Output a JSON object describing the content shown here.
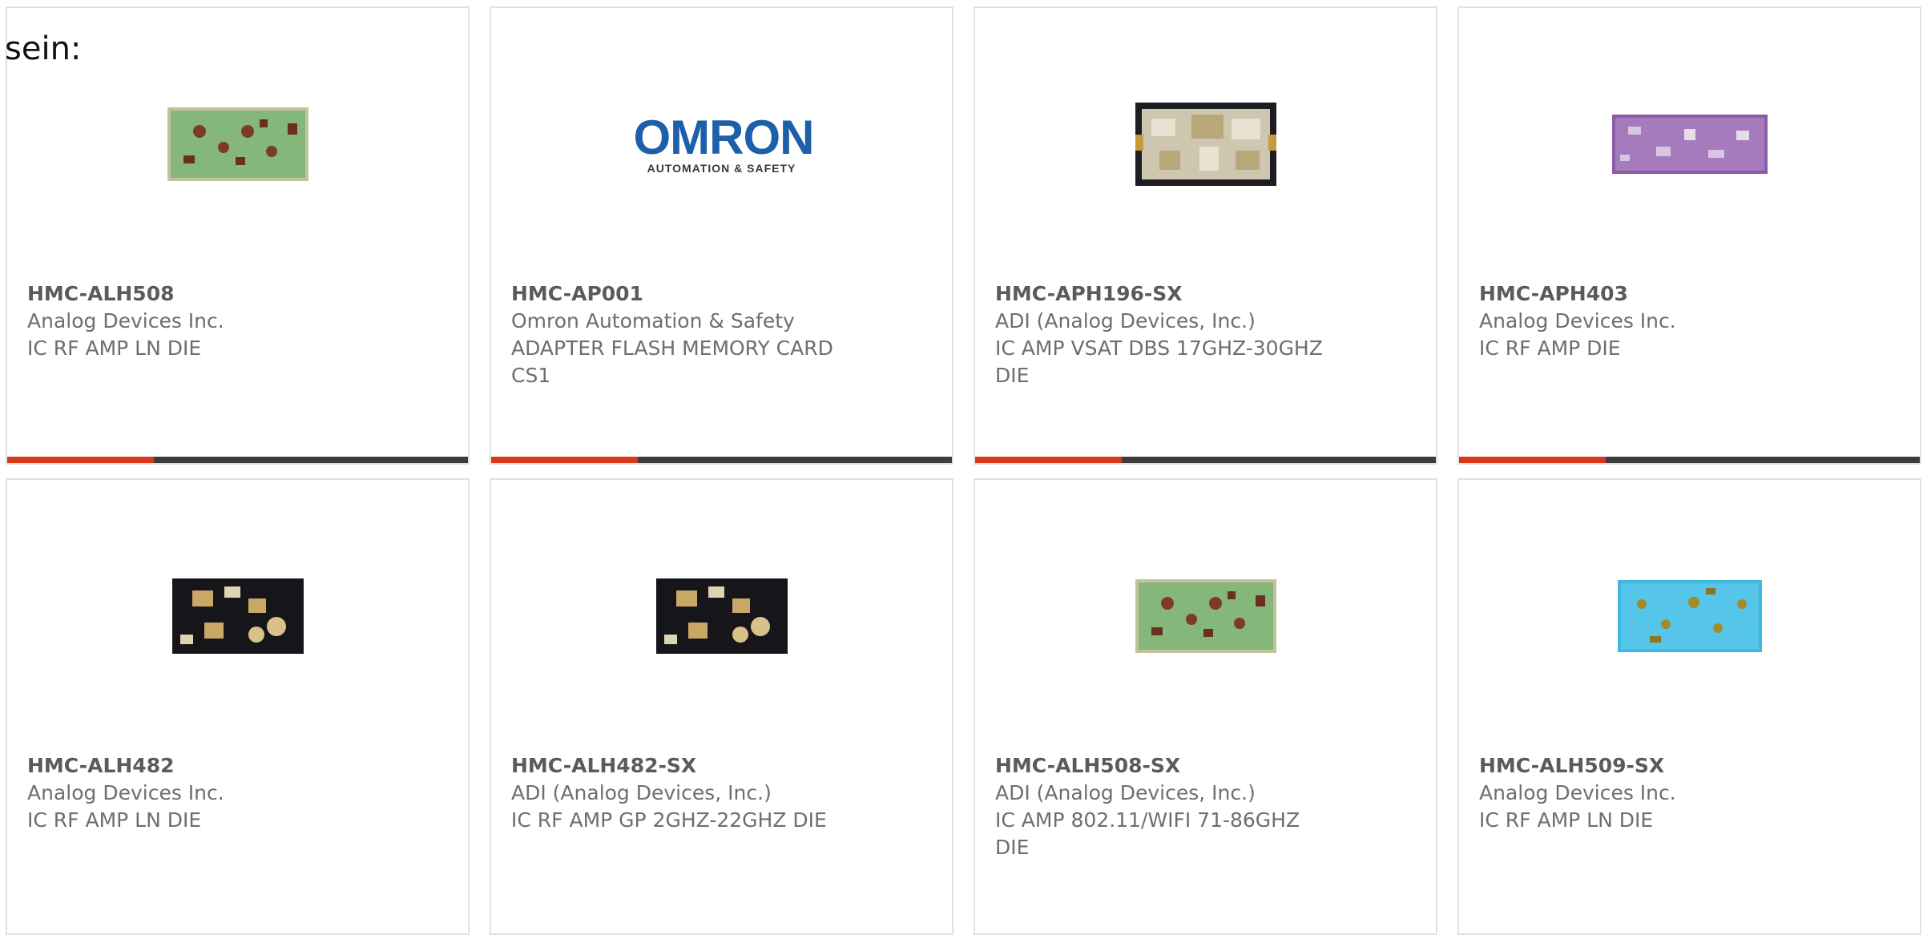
{
  "heading_fragment": "sein:",
  "accent_color": "#d9391a",
  "products": [
    {
      "part": "HMC-ALH508",
      "manufacturer": "Analog Devices Inc.",
      "description": "IC RF AMP LN DIE",
      "image": "green-die-chip"
    },
    {
      "part": "HMC-AP001",
      "manufacturer": "Omron Automation & Safety",
      "description": "ADAPTER FLASH MEMORY CARD CS1",
      "image": "omron-logo"
    },
    {
      "part": "HMC-APH196-SX",
      "manufacturer": "ADI (Analog Devices, Inc.)",
      "description": "IC AMP VSAT DBS 17GHZ-30GHZ DIE",
      "image": "gold-black-die-chip"
    },
    {
      "part": "HMC-APH403",
      "manufacturer": "Analog Devices Inc.",
      "description": "IC RF AMP DIE",
      "image": "purple-die-chip"
    },
    {
      "part": "HMC-ALH482",
      "manufacturer": "Analog Devices Inc.",
      "description": "IC RF AMP LN DIE",
      "image": "black-gold-die-chip"
    },
    {
      "part": "HMC-ALH482-SX",
      "manufacturer": "ADI (Analog Devices, Inc.)",
      "description": "IC RF AMP GP 2GHZ-22GHZ DIE",
      "image": "black-gold-die-chip"
    },
    {
      "part": "HMC-ALH508-SX",
      "manufacturer": "ADI (Analog Devices, Inc.)",
      "description": "IC AMP 802.11/WIFI 71-86GHZ DIE",
      "image": "green-die-chip"
    },
    {
      "part": "HMC-ALH509-SX",
      "manufacturer": "Analog Devices Inc.",
      "description": "IC RF AMP LN DIE",
      "image": "blue-die-chip"
    }
  ],
  "logo": {
    "brand": "OMRON",
    "tagline": "AUTOMATION & SAFETY"
  }
}
